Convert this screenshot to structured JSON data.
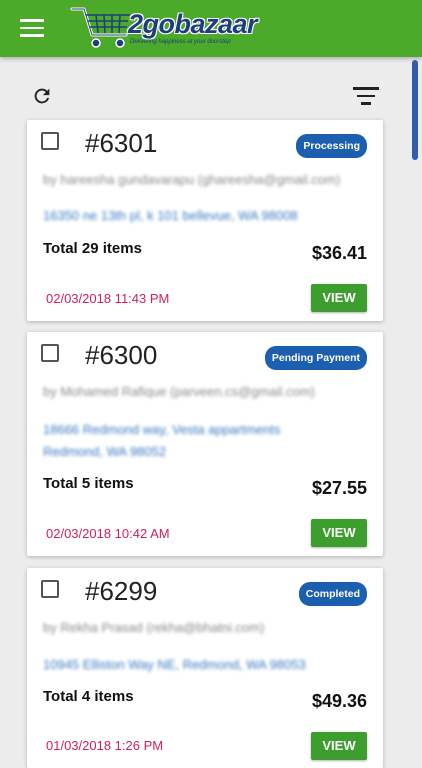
{
  "app": {
    "logo_text": "2gobazaar",
    "logo_tagline": "Delivering happiness at your doorstep"
  },
  "colors": {
    "brand_green": "#4caa2a",
    "badge_blue": "#1c5fae",
    "date_pink": "#d0215d",
    "view_green": "#3c9e2c"
  },
  "icons": {
    "menu": "menu-icon",
    "refresh": "refresh-icon",
    "filter": "filter-icon",
    "cart": "cart-logo-icon"
  },
  "orders": [
    {
      "number": "#6301",
      "status": "Processing",
      "customer": "by hareesha gundavarapu (ghareesha@gmail.com)",
      "address_line1": "16350 ne 13th pl, k 101 bellevue, WA 98008",
      "address_line2": "",
      "total_items": "Total 29 items",
      "amount": "$36.41",
      "date": "02/03/2018 11:43 PM",
      "view_label": "VIEW"
    },
    {
      "number": "#6300",
      "status": "Pending Payment",
      "customer": "by Mohamed Rafique (parveen.cs@gmail.com)",
      "address_line1": "18666 Redmond way, Vesta appartments",
      "address_line2": "Redmond, WA 98052",
      "total_items": "Total 5 items",
      "amount": "$27.55",
      "date": "02/03/2018 10:42 AM",
      "view_label": "VIEW"
    },
    {
      "number": "#6299",
      "status": "Completed",
      "customer": "by Rekha Prasad (rekha@bhatni.com)",
      "address_line1": "10945 Elliston Way NE, Redmond, WA 98053",
      "address_line2": "",
      "total_items": "Total 4 items",
      "amount": "$49.36",
      "date": "01/03/2018 1:26 PM",
      "view_label": "VIEW"
    }
  ]
}
